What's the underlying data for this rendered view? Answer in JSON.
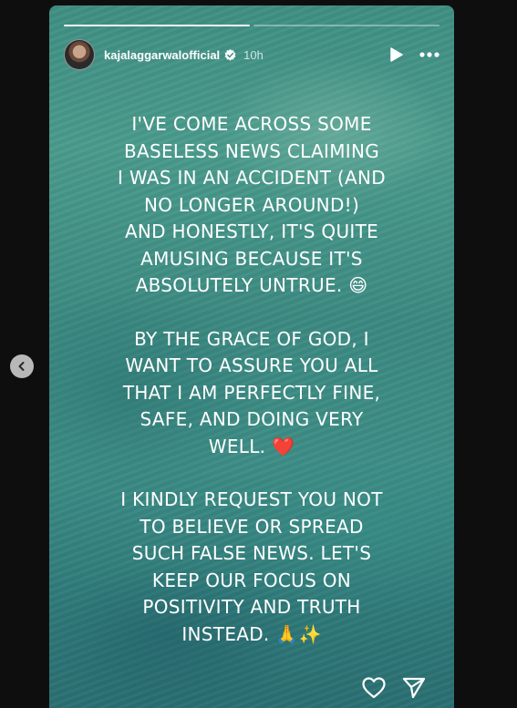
{
  "story": {
    "progress_segments": 2,
    "progress_completed": 1,
    "header": {
      "username": "kajalaggarwalofficial",
      "verified": true,
      "time_ago": "10h",
      "play_icon": "play-icon",
      "more_icon": "more-icon"
    },
    "paragraphs": [
      "I've come across some\nbaseless news claiming\nI was in an accident (and\nno longer around!)\nand honestly, it's quite\namusing because it's\nabsolutely untrue. 😄",
      "By the grace of God, I\nwant to assure you all\nthat I am perfectly fine,\nsafe, and doing very\nwell. ❤️",
      "I kindly request you not\nto believe or spread\nsuch false news. Let's\nkeep our focus on\npositivity and truth\ninstead. 🙏✨"
    ],
    "footer": {
      "like_icon": "heart-icon",
      "share_icon": "send-icon"
    }
  },
  "navigation": {
    "prev_icon": "chevron-left-icon"
  },
  "colors": {
    "page_background": "#0e0e0e",
    "story_water": "#3d8d86",
    "verified_badge": "#3897f0",
    "text": "#ffffff"
  }
}
